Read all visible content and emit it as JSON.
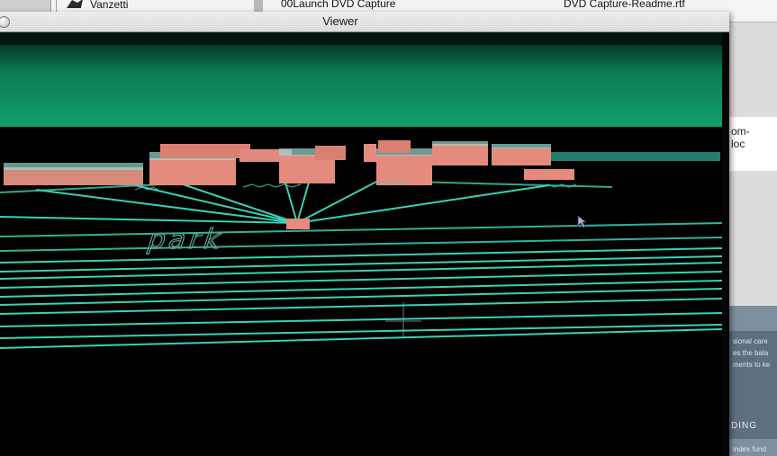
{
  "background_finder": {
    "files": [
      {
        "name": "Vanzetti",
        "icon": "application-icon"
      },
      {
        "name": "00Launch DVD Capture",
        "icon": "document-icon"
      },
      {
        "name": "DVD Capture-Readme.rtf",
        "icon": "document-icon"
      }
    ]
  },
  "background_right_doc": {
    "lines": [
      "om-",
      "loc"
    ]
  },
  "background_brochure": {
    "lines": [
      "sional care",
      "es the bala",
      "ments to ke"
    ],
    "heading": "DING",
    "footer": "index fund"
  },
  "viewer": {
    "title": "Viewer",
    "scene": {
      "ground_label": "park",
      "sky_color": "#0f8a5c",
      "wire_color": "#3ad1b4",
      "building_color": "#e48b7e"
    }
  }
}
